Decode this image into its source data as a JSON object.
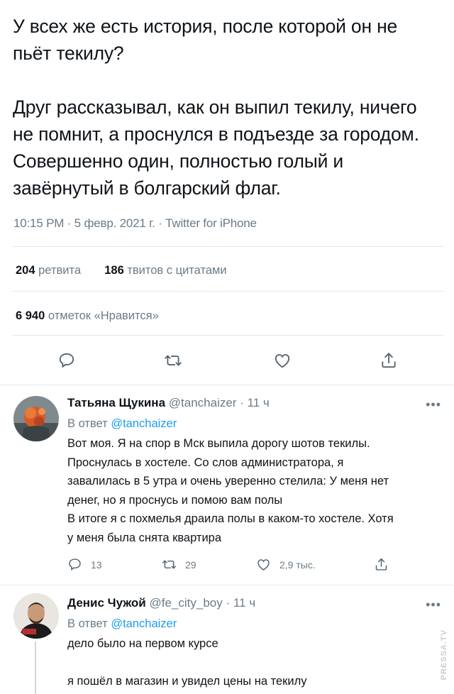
{
  "tweet": {
    "paragraphs": [
      "У всех же есть история, после которой он не пьёт текилу?",
      "Друг рассказывал, как он выпил текилу, ничего не помнит, а проснулся в подъезде за городом. Совершенно один, полностью голый и завёрнутый в болгарский флаг."
    ],
    "meta": "10:15 PM · 5 февр. 2021 г. · Twitter for iPhone",
    "retweets_count": "204",
    "retweets_label": "ретвита",
    "quotes_count": "186",
    "quotes_label": "твитов с цитатами",
    "likes_count": "6 940",
    "likes_label": "отметок «Нравится»"
  },
  "actions": {
    "icons": [
      "reply-icon",
      "retweet-icon",
      "like-icon",
      "share-icon"
    ]
  },
  "replies": [
    {
      "name": "Татьяна Щукина",
      "handle": "@tanchaizer · 11 ч",
      "more": "•••",
      "reply_prefix": "В ответ",
      "reply_mention": "@tanchaizer",
      "lines": [
        "Вот моя. Я на спор в Мск выпила дорогу шотов текилы.",
        "Проснулась в хостеле. Со слов администратора, я",
        "завалилась в 5 утра и очень уверенно стелила: У меня нет",
        "денег, но я проснусь и помою вам полы",
        "В итоге я с похмелья драила полы в каком-то хостеле. Хотя",
        "у меня была снята квартира"
      ],
      "reply_count": "13",
      "retweet_count": "29",
      "like_count": "2,9 тыс."
    },
    {
      "name": "Денис Чужой",
      "handle": "@fe_city_boy · 11 ч",
      "more": "•••",
      "reply_prefix": "В ответ",
      "reply_mention": "@tanchaizer",
      "lines": [
        "дело было на первом курсе",
        "",
        "я пошёл в магазин и увидел цены на текилу"
      ]
    }
  ],
  "watermark": "PRESSA.TV",
  "colors": {
    "text": "#0f1419",
    "secondary": "#6b7b88",
    "link": "#1d9bf0",
    "divider": "#e3e7ea"
  }
}
